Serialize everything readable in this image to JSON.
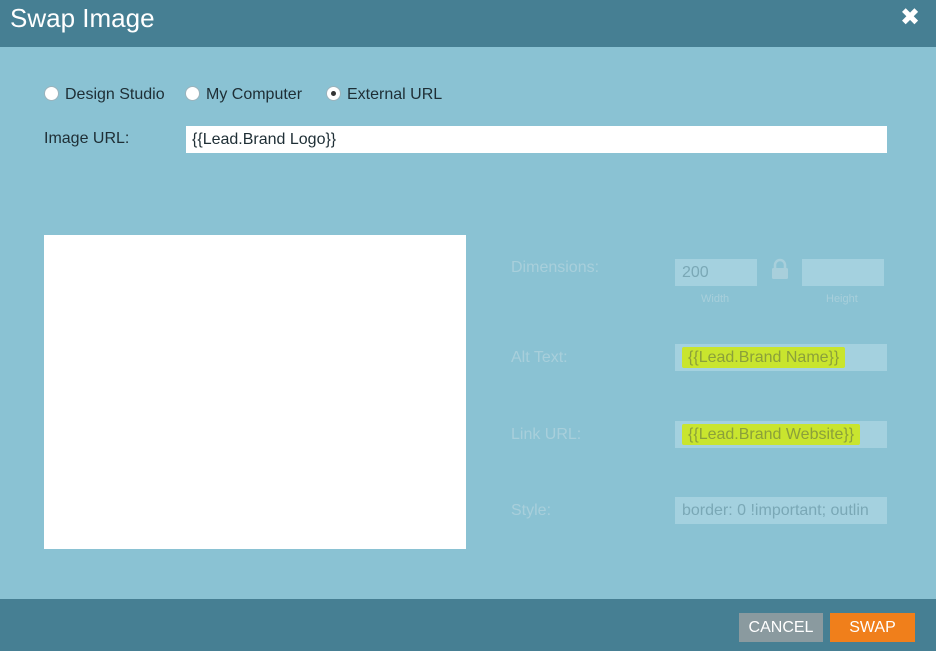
{
  "dialog": {
    "title": "Swap Image",
    "close_label": "✖"
  },
  "source": {
    "options": [
      {
        "label": "Design Studio",
        "selected": false
      },
      {
        "label": "My Computer",
        "selected": false
      },
      {
        "label": "External URL",
        "selected": true
      }
    ]
  },
  "image_url": {
    "label": "Image URL:",
    "value": "{{Lead.Brand Logo}}"
  },
  "properties": {
    "dimensions_label": "Dimensions:",
    "width_value": "200",
    "width_caption": "Width",
    "height_value": "",
    "height_caption": "Height",
    "alt_label": "Alt Text:",
    "alt_value": "{{Lead.Brand Name}}",
    "link_label": "Link URL:",
    "link_value": "{{Lead.Brand Website}}",
    "style_label": "Style:",
    "style_value": "border: 0 !important; outlin"
  },
  "buttons": {
    "cancel": "CANCEL",
    "swap": "SWAP"
  },
  "colors": {
    "header": "#467f93",
    "body": "#8ac2d3",
    "highlight": "#c9e52e",
    "cancel": "#8a9a9f",
    "swap": "#f07f1b"
  },
  "icons": [
    "close-icon",
    "lock-icon"
  ]
}
